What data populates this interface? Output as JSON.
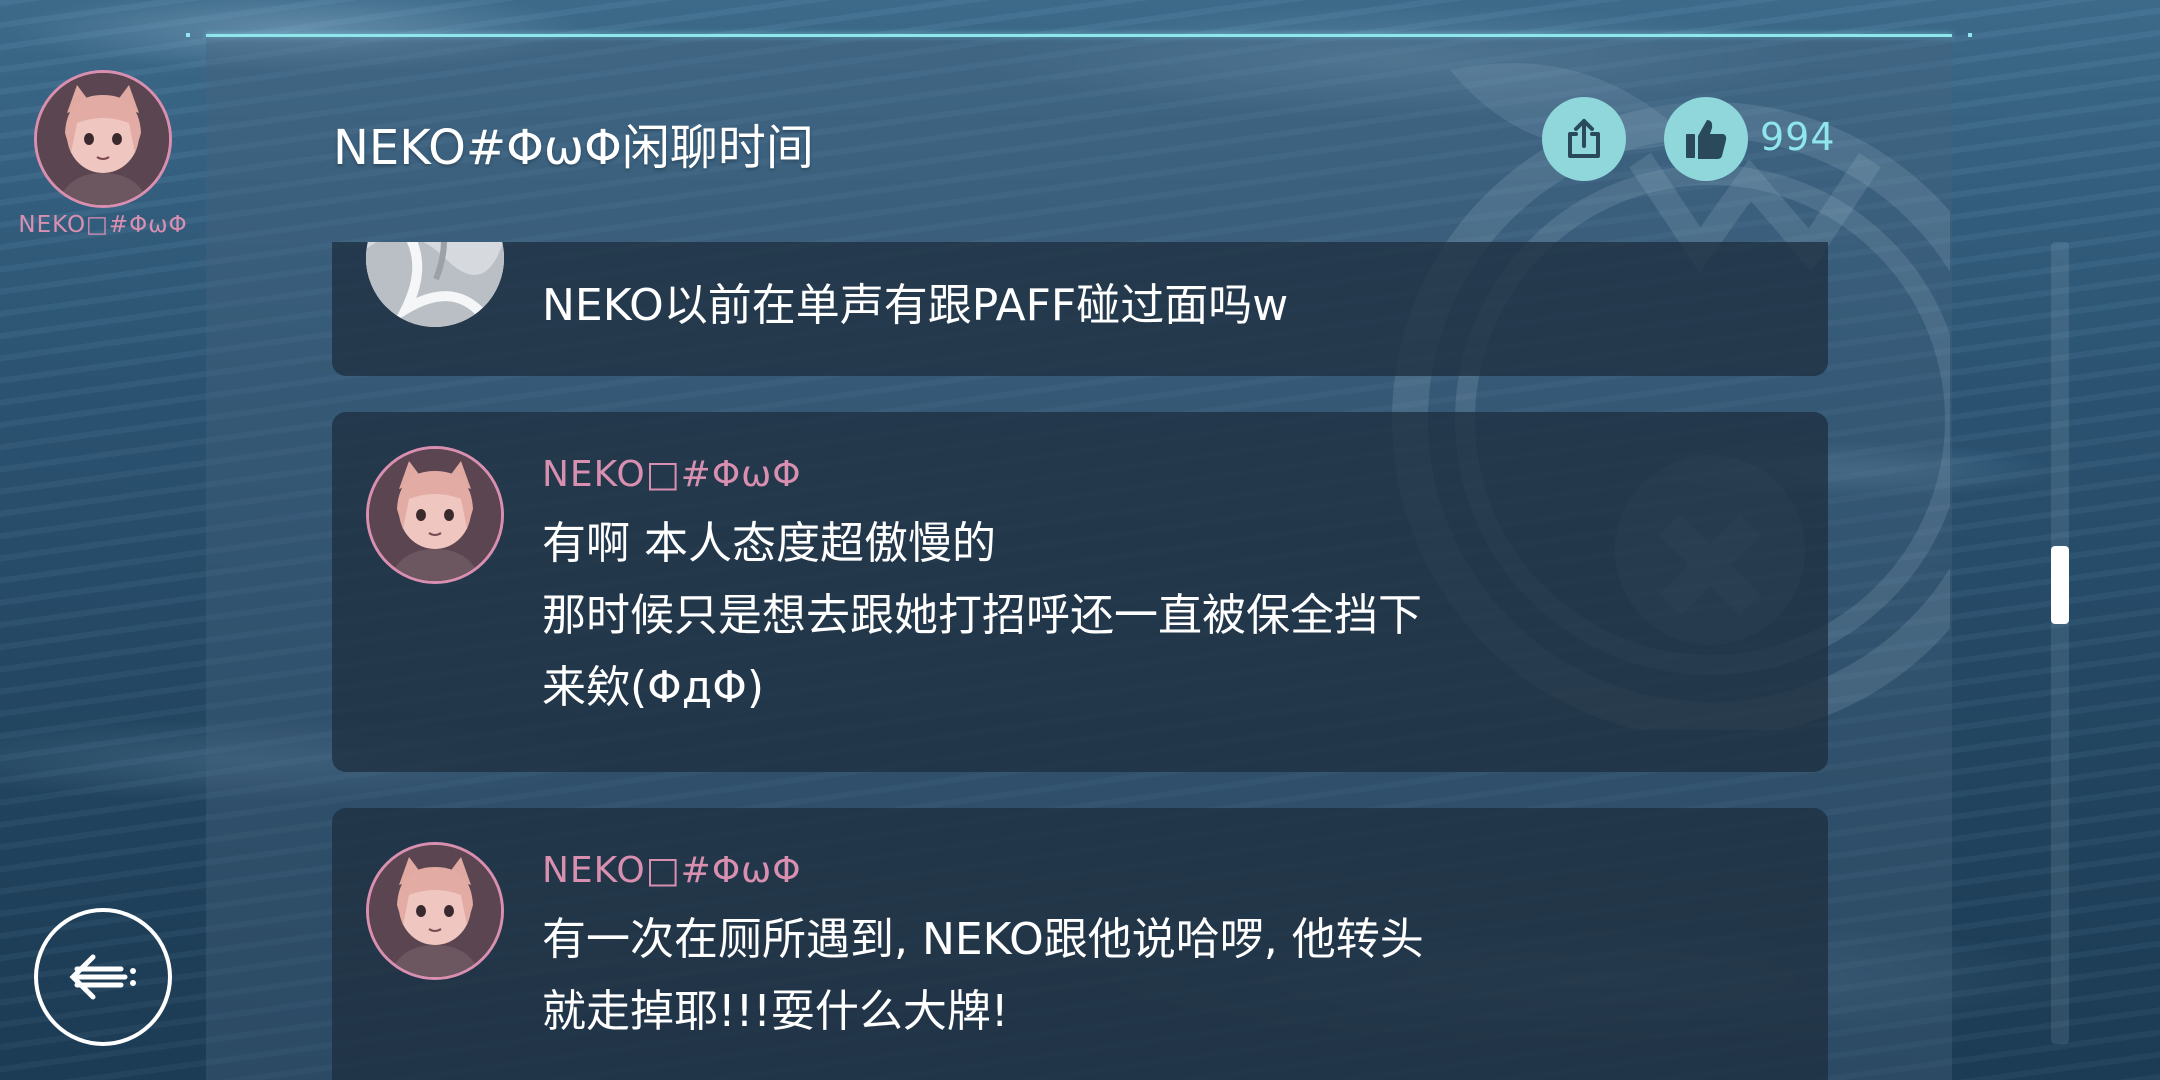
{
  "profile": {
    "name": "NEKO□#ΦωΦ"
  },
  "header": {
    "title": "NEKO#ΦωΦ闲聊时间",
    "like_count": "994"
  },
  "icons": {
    "share": "share-icon",
    "like": "thumbs-up-icon",
    "back": "back-arrow-icon"
  },
  "colors": {
    "accent": "#8fe6ec",
    "author_pink": "#d98fb0",
    "card_bg": "#1f3040",
    "icon_bg": "#8fd7db"
  },
  "comments": [
    {
      "author": "",
      "text": "NEKO以前在单声有跟PAFF碰过面吗w"
    },
    {
      "author": "NEKO□#ΦωΦ",
      "text": "有啊 本人态度超傲慢的\n那时候只是想去跟她打招呼还一直被保全挡下\n来欸(ΦдΦ)"
    },
    {
      "author": "NEKO□#ΦωΦ",
      "text": "有一次在厕所遇到, NEKO跟他说哈啰, 他转头\n就走掉耶!!!耍什么大牌!"
    }
  ],
  "scroll": {
    "position": 0.42
  }
}
